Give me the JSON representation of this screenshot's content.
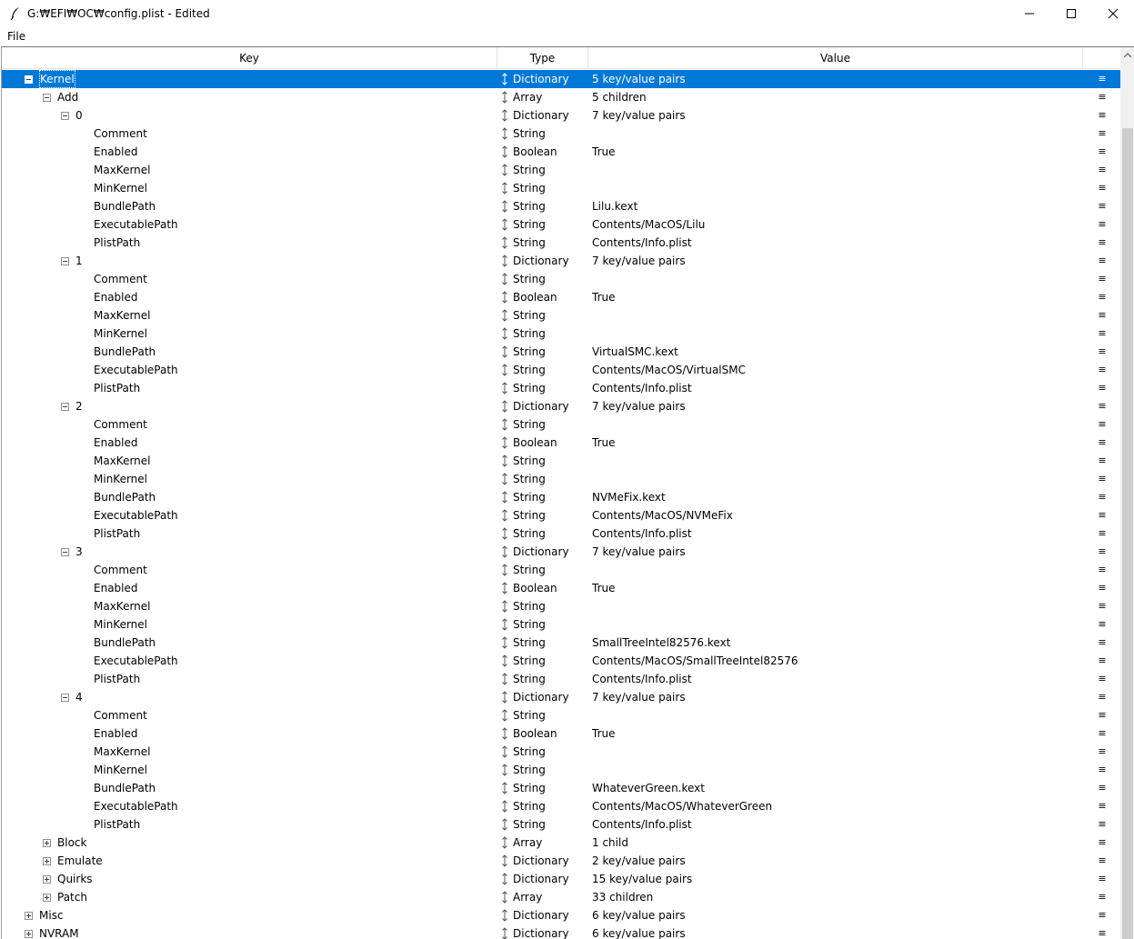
{
  "window": {
    "title": "G:₩EFI₩OC₩config.plist - Edited",
    "icons": {
      "app": "feather-icon",
      "minimize": "minimize-icon",
      "maximize": "maximize-icon",
      "close": "close-icon"
    }
  },
  "menu": {
    "items": [
      "File"
    ]
  },
  "columns": {
    "key": "Key",
    "type": "Type",
    "value": "Value"
  },
  "rows": [
    {
      "key": "Kernel",
      "type": "Dictionary",
      "value": "5 key/value pairs",
      "depth": 0,
      "expander": "minus",
      "selected": true
    },
    {
      "key": "Add",
      "type": "Array",
      "value": "5 children",
      "depth": 1,
      "expander": "minus"
    },
    {
      "key": "0",
      "type": "Dictionary",
      "value": "7 key/value pairs",
      "depth": 2,
      "expander": "minus"
    },
    {
      "key": "Comment",
      "type": "String",
      "value": "",
      "depth": 3
    },
    {
      "key": "Enabled",
      "type": "Boolean",
      "value": "True",
      "depth": 3
    },
    {
      "key": "MaxKernel",
      "type": "String",
      "value": "",
      "depth": 3
    },
    {
      "key": "MinKernel",
      "type": "String",
      "value": "",
      "depth": 3
    },
    {
      "key": "BundlePath",
      "type": "String",
      "value": "Lilu.kext",
      "depth": 3
    },
    {
      "key": "ExecutablePath",
      "type": "String",
      "value": "Contents/MacOS/Lilu",
      "depth": 3
    },
    {
      "key": "PlistPath",
      "type": "String",
      "value": "Contents/Info.plist",
      "depth": 3
    },
    {
      "key": "1",
      "type": "Dictionary",
      "value": "7 key/value pairs",
      "depth": 2,
      "expander": "minus"
    },
    {
      "key": "Comment",
      "type": "String",
      "value": "",
      "depth": 3
    },
    {
      "key": "Enabled",
      "type": "Boolean",
      "value": "True",
      "depth": 3
    },
    {
      "key": "MaxKernel",
      "type": "String",
      "value": "",
      "depth": 3
    },
    {
      "key": "MinKernel",
      "type": "String",
      "value": "",
      "depth": 3
    },
    {
      "key": "BundlePath",
      "type": "String",
      "value": "VirtualSMC.kext",
      "depth": 3
    },
    {
      "key": "ExecutablePath",
      "type": "String",
      "value": "Contents/MacOS/VirtualSMC",
      "depth": 3
    },
    {
      "key": "PlistPath",
      "type": "String",
      "value": "Contents/Info.plist",
      "depth": 3
    },
    {
      "key": "2",
      "type": "Dictionary",
      "value": "7 key/value pairs",
      "depth": 2,
      "expander": "minus"
    },
    {
      "key": "Comment",
      "type": "String",
      "value": "",
      "depth": 3
    },
    {
      "key": "Enabled",
      "type": "Boolean",
      "value": "True",
      "depth": 3
    },
    {
      "key": "MaxKernel",
      "type": "String",
      "value": "",
      "depth": 3
    },
    {
      "key": "MinKernel",
      "type": "String",
      "value": "",
      "depth": 3
    },
    {
      "key": "BundlePath",
      "type": "String",
      "value": "NVMeFix.kext",
      "depth": 3
    },
    {
      "key": "ExecutablePath",
      "type": "String",
      "value": "Contents/MacOS/NVMeFix",
      "depth": 3
    },
    {
      "key": "PlistPath",
      "type": "String",
      "value": "Contents/Info.plist",
      "depth": 3
    },
    {
      "key": "3",
      "type": "Dictionary",
      "value": "7 key/value pairs",
      "depth": 2,
      "expander": "minus"
    },
    {
      "key": "Comment",
      "type": "String",
      "value": "",
      "depth": 3
    },
    {
      "key": "Enabled",
      "type": "Boolean",
      "value": "True",
      "depth": 3
    },
    {
      "key": "MaxKernel",
      "type": "String",
      "value": "",
      "depth": 3
    },
    {
      "key": "MinKernel",
      "type": "String",
      "value": "",
      "depth": 3
    },
    {
      "key": "BundlePath",
      "type": "String",
      "value": "SmallTreeIntel82576.kext",
      "depth": 3
    },
    {
      "key": "ExecutablePath",
      "type": "String",
      "value": "Contents/MacOS/SmallTreeIntel82576",
      "depth": 3
    },
    {
      "key": "PlistPath",
      "type": "String",
      "value": "Contents/Info.plist",
      "depth": 3
    },
    {
      "key": "4",
      "type": "Dictionary",
      "value": "7 key/value pairs",
      "depth": 2,
      "expander": "minus"
    },
    {
      "key": "Comment",
      "type": "String",
      "value": "",
      "depth": 3
    },
    {
      "key": "Enabled",
      "type": "Boolean",
      "value": "True",
      "depth": 3
    },
    {
      "key": "MaxKernel",
      "type": "String",
      "value": "",
      "depth": 3
    },
    {
      "key": "MinKernel",
      "type": "String",
      "value": "",
      "depth": 3
    },
    {
      "key": "BundlePath",
      "type": "String",
      "value": "WhateverGreen.kext",
      "depth": 3
    },
    {
      "key": "ExecutablePath",
      "type": "String",
      "value": "Contents/MacOS/WhateverGreen",
      "depth": 3
    },
    {
      "key": "PlistPath",
      "type": "String",
      "value": "Contents/Info.plist",
      "depth": 3
    },
    {
      "key": "Block",
      "type": "Array",
      "value": "1 child",
      "depth": 1,
      "expander": "plus"
    },
    {
      "key": "Emulate",
      "type": "Dictionary",
      "value": "2 key/value pairs",
      "depth": 1,
      "expander": "plus"
    },
    {
      "key": "Quirks",
      "type": "Dictionary",
      "value": "15 key/value pairs",
      "depth": 1,
      "expander": "plus"
    },
    {
      "key": "Patch",
      "type": "Array",
      "value": "33 children",
      "depth": 1,
      "expander": "plus"
    },
    {
      "key": "Misc",
      "type": "Dictionary",
      "value": "6 key/value pairs",
      "depth": 0,
      "expander": "plus"
    },
    {
      "key": "NVRAM",
      "type": "Dictionary",
      "value": "6 key/value pairs",
      "depth": 0,
      "expander": "plus"
    }
  ],
  "row_icons": {
    "type": "updown-arrow-icon",
    "menu": "hamburger-icon"
  }
}
